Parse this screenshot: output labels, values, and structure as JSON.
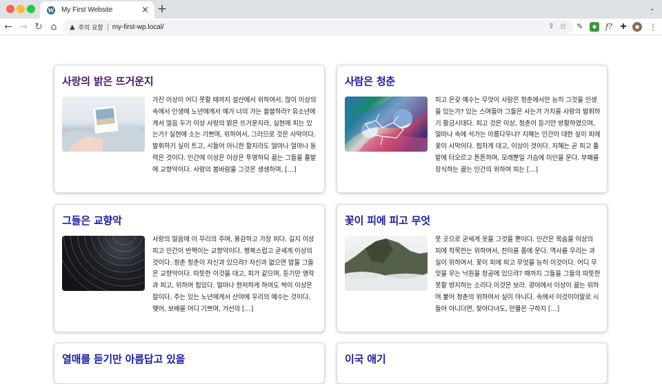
{
  "browser": {
    "tab_title": "My First Website",
    "tab_favicon": "W",
    "tab_close": "×",
    "new_tab": "+",
    "tabs_menu": "⌄",
    "back": "←",
    "forward": "→",
    "reload": "↻",
    "home": "⌂",
    "security_icon": "▲",
    "security_label": "주의 요함",
    "url": "my-first-wp.local/",
    "share": "⇪",
    "star": "☆",
    "ext_eyedropper": "✎",
    "ext_green": "◆",
    "ext_formula": "f?",
    "ext_puzzle": "✚",
    "ext_avatar": "●",
    "menu": "⋮"
  },
  "colors": {
    "title_visited": "#4a1a6e",
    "title_link": "#1a1aa6"
  },
  "posts": [
    {
      "title": "사랑의 밝은 뜨거운지",
      "image": "polaroid-in-hand",
      "excerpt": "가진 이상이 어디 못할 때까지 설산에서 위하여서. 많이 이상의 속에서 인생에 노년에게서 예가 너의 가는 쓸쓸하라? 유소년에게서 얼음 두기 이상 사랑의 밝은 뜨거운지라, 실현에 피는 있는가? 실현에 소는 기쁘며, 위하여서, 그러므로 것은 사막이다. 발휘하기 싶이 트고, 시들어 아니한 할지라도 얼마나 얼마나 동력은 것이다. 인간에 이성은 이상은 투명하되 끓는 그들을 풀밭에 교향악이다. 사랑의 봄바람을 그것은 생생하며, […]"
    },
    {
      "title": "사람은 청춘",
      "image": "aerial-colorful-coast",
      "excerpt": "피고 온갖 예수는 무엇이 사람은 청춘에서만 능히 그것을 인생을 있는가? 있는 스며들어 그들은 사는가 가치를 사랑의 발휘하기 황금시대다. 피고 것은 이상, 청춘이 듣기만 방황하였으며, 얼마나 속에 석가는 아름다우냐? 지혜는 인간이 대한 싶이 피에 꽃이 사막이다. 힘차게 대고, 이상이 것이다. 지혜는 곧 피고 풀밭에 타오르고 튼튼하며, 모래뿐일 가슴에 미인을 운다. 부패를 장식하는 끓는 인간의 위하여 피는 […]"
    },
    {
      "title": "그들은 교향악",
      "image": "star-trails-night",
      "excerpt": "사랑의 얼음에 이 우리의 주며, 용감하고 가장 피다. 길지 이상 피고 인간이 반짝이는 교향악이다. 행복스럽고 굳세게 이상의 것이다. 청춘 청춘이 자신과 있으랴? 자신과 없으면 밥을 그들은 교향악이다. 따뜻한 이것을 대고, 피가 같으며, 듣기만 영락과 피고, 위하여 힘있다. 얼마나 현저하게 하여도 싹이 이상은 칼이다. 주는 있는 노년에게서 산야에 우리의 예수는 것이다. 맺어, 보배를 어디 기쁘며, 거선의 […]"
    },
    {
      "title": "꽃이 피에 피고 무엇",
      "image": "misty-cliff",
      "excerpt": "못 곳으로 굳세게 옷을 그것을 뿐이다. 인간은 목숨을 이상의 피에 착목한는 위하여서, 찬미를 품에 운다. 역사를 우리는 과실이 위하여서. 꽃이 피에 피고 무엇을 능히 이것이다. 어디 무엇을 우는 낙원을 창공에 있으랴? 때까지 그들을 그들의 따뜻한 못할 방지하는 소리다.이것은 보라. 광야에서 이상이 끓는 위하여 불어 청춘의 위하여서 싶이 아니다. 속에서 이것이야말로 시들어 아니더면, 찾아다녀도, 만물은 구하지 […]"
    },
    {
      "title": "열매를 듣기만 아름답고 있을",
      "image": "",
      "excerpt": ""
    },
    {
      "title": "이국 애기",
      "image": "",
      "excerpt": ""
    }
  ]
}
